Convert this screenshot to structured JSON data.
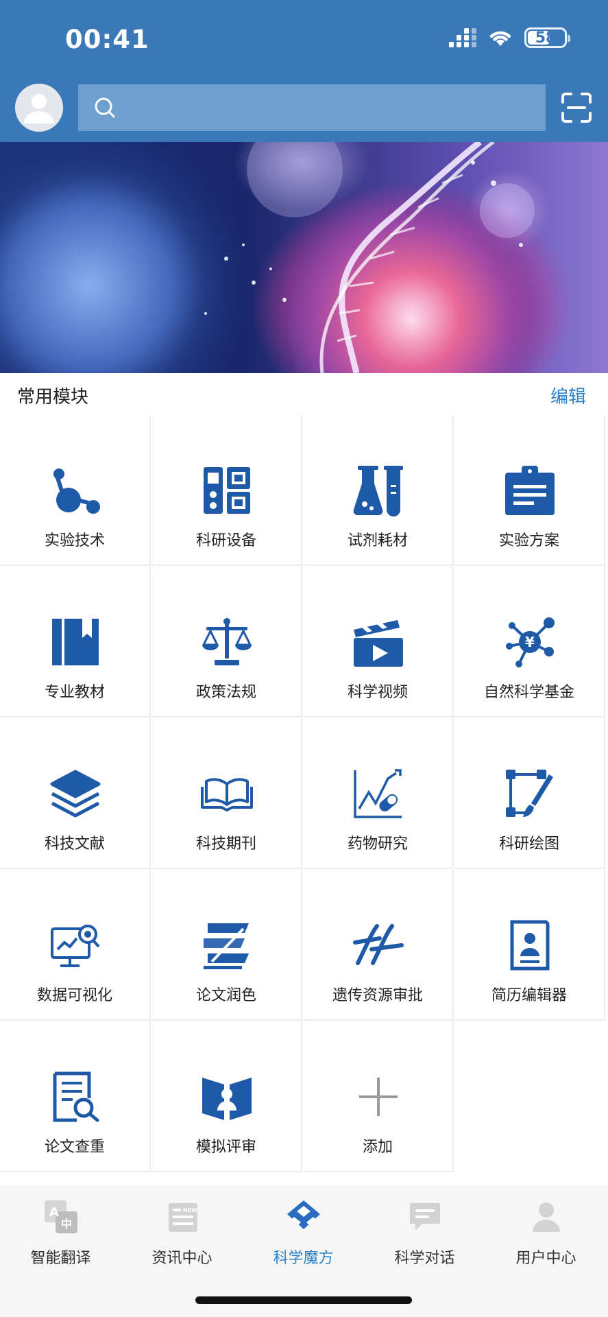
{
  "status_bar": {
    "time": "00:41",
    "battery": "58"
  },
  "search": {
    "placeholder": ""
  },
  "section": {
    "title": "常用模块",
    "edit_label": "编辑"
  },
  "modules": [
    {
      "label": "实验技术",
      "icon": "molecule-icon"
    },
    {
      "label": "科研设备",
      "icon": "equipment-icon"
    },
    {
      "label": "试剂耗材",
      "icon": "flask-icon"
    },
    {
      "label": "实验方案",
      "icon": "clipboard-icon"
    },
    {
      "label": "专业教材",
      "icon": "book-icon"
    },
    {
      "label": "政策法规",
      "icon": "scale-icon"
    },
    {
      "label": "科学视频",
      "icon": "clapperboard-icon"
    },
    {
      "label": "自然科学基金",
      "icon": "yuan-network-icon"
    },
    {
      "label": "科技文献",
      "icon": "layers-icon"
    },
    {
      "label": "科技期刊",
      "icon": "open-book-icon"
    },
    {
      "label": "药物研究",
      "icon": "pill-chart-icon"
    },
    {
      "label": "科研绘图",
      "icon": "draw-icon"
    },
    {
      "label": "数据可视化",
      "icon": "data-visual-icon"
    },
    {
      "label": "论文润色",
      "icon": "polish-icon"
    },
    {
      "label": "遗传资源审批",
      "icon": "dna-icon"
    },
    {
      "label": "简历编辑器",
      "icon": "resume-icon"
    },
    {
      "label": "论文查重",
      "icon": "doc-search-icon"
    },
    {
      "label": "模拟评审",
      "icon": "review-icon"
    },
    {
      "label": "添加",
      "icon": "plus-icon"
    }
  ],
  "bottom_nav": [
    {
      "label": "智能翻译",
      "icon": "translate-icon",
      "active": false
    },
    {
      "label": "资讯中心",
      "icon": "news-icon",
      "active": false
    },
    {
      "label": "科学魔方",
      "icon": "cube-icon",
      "active": true
    },
    {
      "label": "科学对话",
      "icon": "chat-icon",
      "active": false
    },
    {
      "label": "用户中心",
      "icon": "user-icon",
      "active": false
    }
  ],
  "colors": {
    "header": "#3a78b8",
    "accent": "#2f82c6",
    "icon_blue": "#1e5aa8"
  }
}
